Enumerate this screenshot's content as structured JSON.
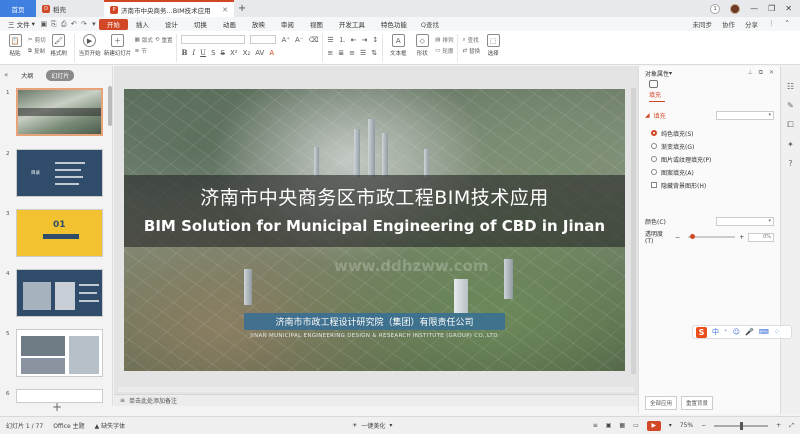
{
  "titlebar": {
    "home_tab": "首页",
    "doc_tab_1": "稻壳",
    "doc_tab_2": "济南市中央商务...BIM技术应用",
    "add_tab": "+"
  },
  "menubar": {
    "file_label": "三 文件",
    "items": [
      "开始",
      "插入",
      "设计",
      "切换",
      "动画",
      "放映",
      "审阅",
      "视图",
      "开发工具",
      "特色功能"
    ],
    "active": "开始",
    "search_label": "Q查找",
    "right": [
      "未同步",
      "协作",
      "分享"
    ]
  },
  "ribbon": {
    "paste": "粘贴",
    "cut": "剪切",
    "copy": "复制",
    "format_painter": "格式刷",
    "play_from_current": "当页开始",
    "new_slide": "新建幻灯片",
    "layout": "版式",
    "section": "节",
    "reset": "重置",
    "textbox": "文本框",
    "shape": "形状",
    "arrange": "排列",
    "outline": "轮廓",
    "find": "查找",
    "replace": "替换",
    "select": "选择"
  },
  "left_panel": {
    "tab_outline": "大纲",
    "tab_slides": "幻灯片",
    "slide_numbers": [
      "1",
      "2",
      "3",
      "4",
      "5",
      "6"
    ],
    "thumb2_label": "目录",
    "thumb3_label": "01"
  },
  "slide": {
    "title_zh": "济南市中央商务区市政工程BIM技术应用",
    "title_en": "BIM Solution for Municipal Engineering of CBD in Jinan",
    "org_zh": "济南市市政工程设计研究院（集团）有限责任公司",
    "org_en": "JINAN MUNICIPAL ENGINEERING DESIGN & RESEARCH INSTITUTE (GROUP) CO.,LTD",
    "watermark": "www.ddhzww.com"
  },
  "notes": {
    "placeholder": "单击此处添加备注"
  },
  "right_panel": {
    "title": "对象属性",
    "tab_fill": "填充",
    "section_fill": "填充",
    "options": [
      "纯色填充(S)",
      "渐变填充(G)",
      "图片或纹理填充(P)",
      "图案填充(A)",
      "隐藏背景图形(H)"
    ],
    "selected_option": "纯色填充(S)",
    "color_label": "颜色(C)",
    "transparency_label": "透明度(T)",
    "transparency_value": "0%",
    "apply_all": "全部应用",
    "reset_bg": "重置背景"
  },
  "statusbar": {
    "slide_count": "幻灯片 1 / 77",
    "theme": "Office 主题",
    "missing_font": "缺失字体",
    "beautify": "一键美化",
    "zoom": "75%"
  },
  "colors": {
    "accent": "#d24726",
    "home_tab": "#3f7fe0",
    "thumb_dark": "#2f4d6b",
    "thumb_yellow": "#f2c230"
  }
}
